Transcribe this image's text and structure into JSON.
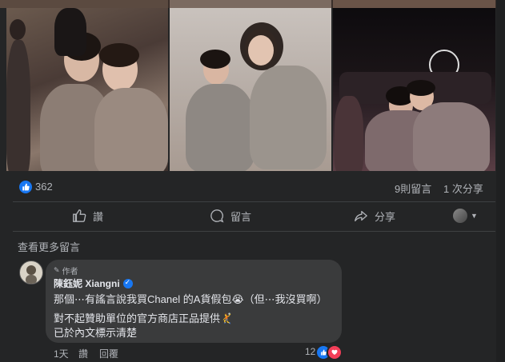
{
  "post": {
    "reactions_count": "362",
    "comments_count": "9則留言",
    "shares_count": "1 次分享"
  },
  "actions": {
    "like_label": "讚",
    "comment_label": "留言",
    "share_label": "分享"
  },
  "comments": {
    "view_more": "查看更多留言",
    "items": [
      {
        "author_tag": "作者",
        "author": "陳鈺妮 Xiangni",
        "text_line1": "那個⋯有謠言說我買Chanel 的A貨假包😭（但⋯我沒買啊）",
        "text_line2": "對不起贊助單位的官方商店正品提供🤾",
        "text_line3": "已於內文標示清楚",
        "time": "1天",
        "like_label": "讚",
        "reply_label": "回覆",
        "reaction_count": "12"
      }
    ]
  },
  "colors": {
    "background": "#242526",
    "bubble": "#3a3b3c",
    "accent": "#1877f2",
    "love": "#f33e58"
  }
}
